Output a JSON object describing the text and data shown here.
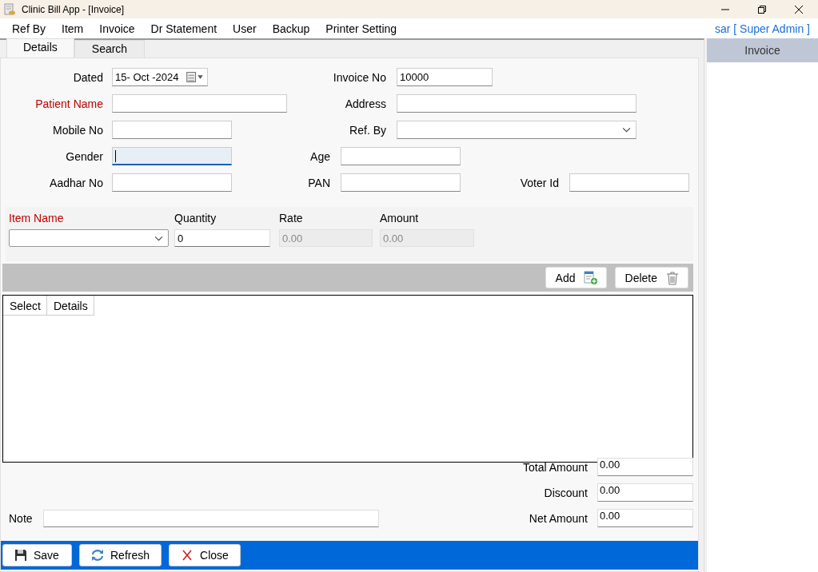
{
  "window": {
    "title": "Clinic Bill App - [Invoice]"
  },
  "menu": [
    "Ref By",
    "Item",
    "Invoice",
    "Dr Statement",
    "User",
    "Backup",
    "Printer Setting"
  ],
  "user": "sar [ Super Admin ]",
  "tabs": [
    {
      "label": "Details",
      "selected": true
    },
    {
      "label": "Search",
      "selected": false
    }
  ],
  "form": {
    "rows": [
      [
        {
          "label": "Dated",
          "kind": "date",
          "value": "15- Oct -2024",
          "required": false
        },
        {
          "label": "Invoice No",
          "kind": "text",
          "value": "10000",
          "required": false,
          "focused": false
        }
      ],
      [
        {
          "label": "Patient Name",
          "kind": "text",
          "required": true,
          "focused": false
        },
        {
          "label": "Address",
          "kind": "text",
          "required": false,
          "focused": false
        }
      ],
      [
        {
          "label": "Mobile No",
          "kind": "text",
          "required": false,
          "focused": false
        },
        {
          "label": "Ref. By",
          "kind": "select",
          "required": false
        }
      ],
      [
        {
          "label": "Gender",
          "kind": "text",
          "required": false,
          "focused": true
        },
        {
          "label": "Age",
          "kind": "text",
          "required": false,
          "focused": false
        }
      ],
      [
        {
          "label": "Aadhar No",
          "kind": "text",
          "required": false,
          "focused": false
        },
        {
          "label": "PAN",
          "kind": "text",
          "required": false,
          "focused": false
        },
        {
          "label": "Voter Id",
          "kind": "text",
          "required": false,
          "focused": false
        }
      ]
    ]
  },
  "item_entry": [
    {
      "label": "Item Name",
      "kind": "select",
      "required": true
    },
    {
      "label": "Quantity",
      "kind": "text",
      "value": "0",
      "required": false,
      "disabled": false
    },
    {
      "label": "Rate",
      "kind": "text",
      "value": "0.00",
      "required": false,
      "disabled": true
    },
    {
      "label": "Amount",
      "kind": "text",
      "value": "0.00",
      "required": false,
      "disabled": true
    }
  ],
  "grid_buttons": [
    {
      "label": "Add",
      "kind": "add"
    },
    {
      "label": "Delete",
      "kind": "delete"
    }
  ],
  "table": {
    "columns": [
      "Select",
      "Details"
    ]
  },
  "totals": [
    {
      "label": "Total Amount",
      "value": "0.00"
    },
    {
      "label": "Discount",
      "value": "0.00"
    },
    {
      "label": "Net Amount",
      "value": "0.00"
    }
  ],
  "note": {
    "label": "Note"
  },
  "actions": [
    {
      "label": "Save",
      "kind": "save"
    },
    {
      "label": "Refresh",
      "kind": "refresh"
    },
    {
      "label": "Close",
      "kind": "close"
    }
  ],
  "side_panel": {
    "title": "Invoice"
  }
}
